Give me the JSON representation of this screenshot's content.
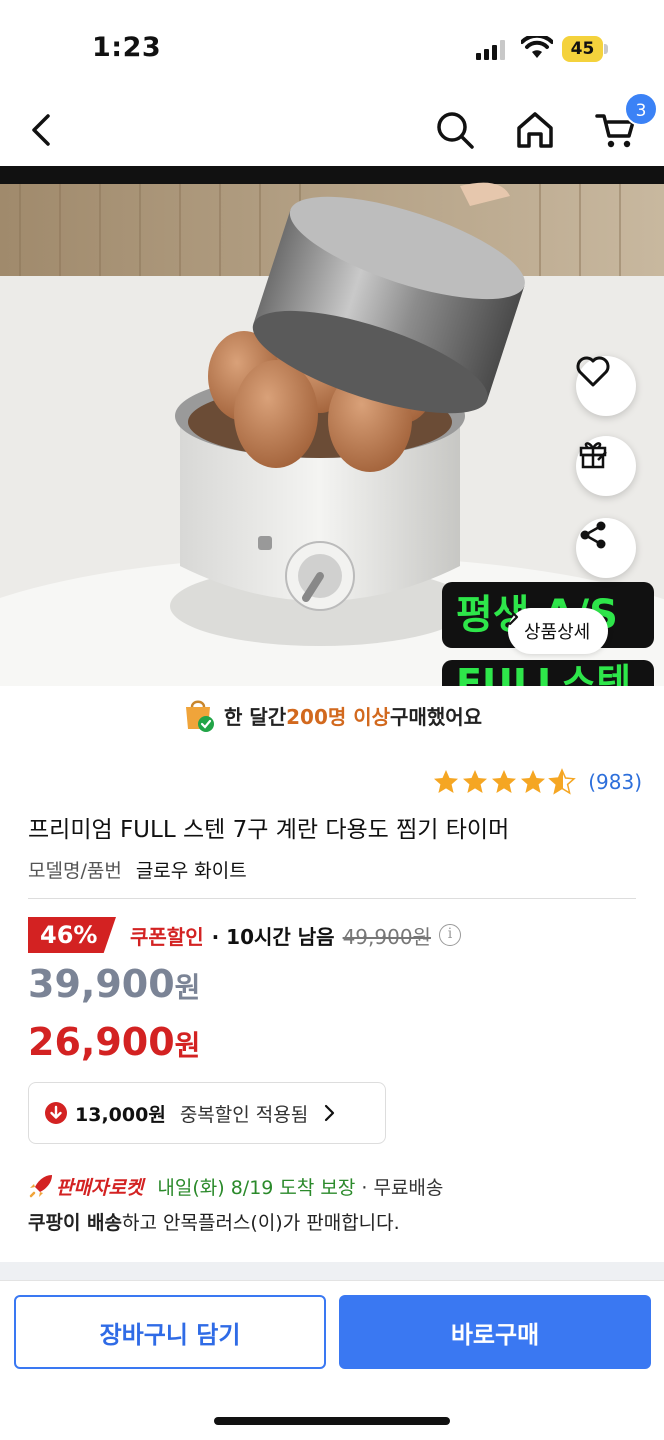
{
  "status_bar": {
    "time": "1:23",
    "battery": "45"
  },
  "nav": {
    "cart_count": "3"
  },
  "product_image": {
    "detail_button": "상품상세"
  },
  "purchase_banner": {
    "pre": "한 달간 ",
    "highlight": "200명 이상",
    "post": " 구매했어요"
  },
  "rating": {
    "stars": 4.5,
    "count": "(983)"
  },
  "product": {
    "title": "프리미엄 FULL 스텐 7구 계란 다용도 찜기 타이머",
    "model_label": "모델명/품번",
    "model_value": "글로우 화이트"
  },
  "pricing": {
    "discount_percent": "46%",
    "coupon_label": "쿠폰할인",
    "time_left": "· 10시간 남음",
    "original_price": "49,900원",
    "sale_price_number": "39,900",
    "sale_price_unit": "원",
    "final_price_number": "26,900",
    "final_price_unit": "원"
  },
  "duplicate_discount": {
    "amount": "13,000원",
    "label": "중복할인 적용됨"
  },
  "delivery": {
    "rocket_label": "판매자로켓",
    "arrival": "내일(화) 8/19 도착 보장",
    "free_shipping": "· 무료배송",
    "seller_bold": "쿠팡이 배송",
    "seller_rest": "하고 안목플러스(이)가 판매합니다."
  },
  "actions": {
    "add_to_cart": "장바구니 담기",
    "buy_now": "바로구매"
  },
  "colors": {
    "accent_blue": "#3a78f2",
    "sale_red": "#d32222",
    "arrival_green": "#2b8a2b",
    "star": "#f5a623"
  }
}
